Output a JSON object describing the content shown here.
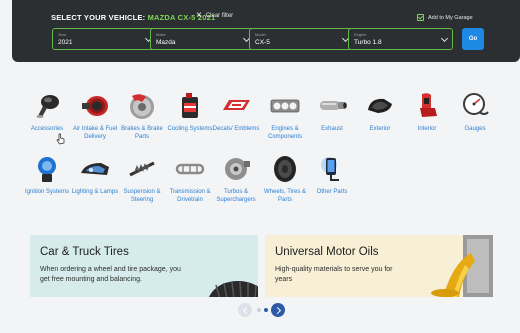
{
  "vehicle_bar": {
    "title_prefix": "SELECT YOUR VEHICLE: ",
    "title_vehicle": "MAZDA CX-5 2021",
    "clear_filter": "Clear filter",
    "add_to_garage": "Add to My Garage",
    "fields": {
      "year": {
        "label": "Year",
        "value": "2021"
      },
      "make": {
        "label": "Make",
        "value": "Mazda"
      },
      "model": {
        "label": "Model",
        "value": "CX-5"
      },
      "engine": {
        "label": "Engine",
        "value": "Turbo 1.8"
      }
    },
    "go_label": "Go"
  },
  "categories": [
    {
      "name": "Accessories",
      "icon": "shift-knob-icon"
    },
    {
      "name": "Air Intake & Fuel Delivery",
      "icon": "air-filter-icon"
    },
    {
      "name": "Brakes & Brake Parts",
      "icon": "brake-disc-icon"
    },
    {
      "name": "Cooling Systems",
      "icon": "coolant-bottle-icon"
    },
    {
      "name": "Decals/ Emblems",
      "icon": "decal-icon"
    },
    {
      "name": "Engines & Components",
      "icon": "gasket-icon"
    },
    {
      "name": "Exhaust",
      "icon": "exhaust-icon"
    },
    {
      "name": "Exterior",
      "icon": "side-mirror-icon"
    },
    {
      "name": "Interior",
      "icon": "car-seat-icon"
    },
    {
      "name": "Gauges",
      "icon": "gauge-icon"
    },
    {
      "name": "Ignition Systems",
      "icon": "ignition-coil-icon"
    },
    {
      "name": "Lighting & Lamps",
      "icon": "headlight-icon"
    },
    {
      "name": "Suspension & Steering",
      "icon": "shock-absorber-icon"
    },
    {
      "name": "Transmission & Drivetrain",
      "icon": "chain-icon"
    },
    {
      "name": "Turbos & Superchargers",
      "icon": "turbo-icon"
    },
    {
      "name": "Wheels, Tires & Parts",
      "icon": "tire-icon"
    },
    {
      "name": "Other Parts",
      "icon": "phone-mount-icon"
    }
  ],
  "promos": {
    "tires": {
      "title": "Car & Truck Tires",
      "text": "When ordering a wheel and tire package, you get free mounting and balancing.",
      "bg": "#d6ecec"
    },
    "oils": {
      "title": "Universal Motor Oils",
      "text": "High-quality materials to serve you for years",
      "bg": "#f7efd6"
    }
  },
  "carousel": {
    "active_index": 1,
    "count": 2
  },
  "colors": {
    "accent_green": "#7fd45a",
    "link_blue": "#2f80d0",
    "go_blue": "#1e88e5",
    "bar_bg": "#2b2f31"
  }
}
